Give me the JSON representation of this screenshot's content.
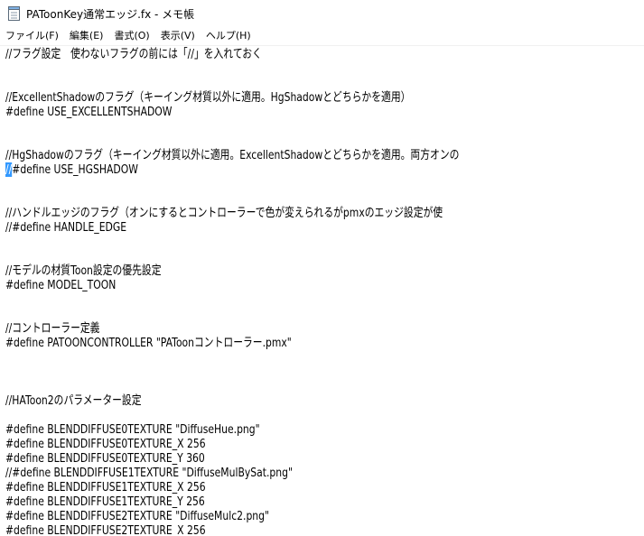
{
  "window": {
    "title": "PAToonKey通常エッジ.fx - メモ帳",
    "app_icon": "notepad-icon"
  },
  "menu": {
    "items": [
      "ファイル(F)",
      "編集(E)",
      "書式(O)",
      "表示(V)",
      "ヘルプ(H)"
    ]
  },
  "editor": {
    "lines": [
      "//フラグ設定　使わないフラグの前には「//」を入れておく",
      "",
      "",
      "//ExcellentShadowのフラグ（キーイング材質以外に適用。HgShadowとどちらかを適用）",
      "#define USE_EXCELLENTSHADOW",
      "",
      "",
      "//HgShadowのフラグ（キーイング材質以外に適用。ExcellentShadowとどちらかを適用。両方オンの",
      "//#define USE_HGSHADOW",
      "",
      "",
      "//ハンドルエッジのフラグ（オンにするとコントローラーで色が変えられるがpmxのエッジ設定が使",
      "//#define HANDLE_EDGE",
      "",
      "",
      "//モデルの材質Toon設定の優先設定",
      "#define MODEL_TOON",
      "",
      "",
      "//コントローラー定義",
      "#define PATOONCONTROLLER \"PAToonコントローラー.pmx\"",
      "",
      "",
      "",
      "//HAToon2のパラメーター設定",
      "",
      "#define BLENDDIFFUSE0TEXTURE \"DiffuseHue.png\"",
      "#define BLENDDIFFUSE0TEXTURE_X 256",
      "#define BLENDDIFFUSE0TEXTURE_Y 360",
      "//#define BLENDDIFFUSE1TEXTURE \"DiffuseMulBySat.png\"",
      "#define BLENDDIFFUSE1TEXTURE_X 256",
      "#define BLENDDIFFUSE1TEXTURE_Y 256",
      "#define BLENDDIFFUSE2TEXTURE \"DiffuseMulc2.png\"",
      "#define BLENDDIFFUSE2TEXTURE_X 256"
    ],
    "selected_text": "//",
    "selected_line_rest": "#define USE_HGSHADOW"
  }
}
